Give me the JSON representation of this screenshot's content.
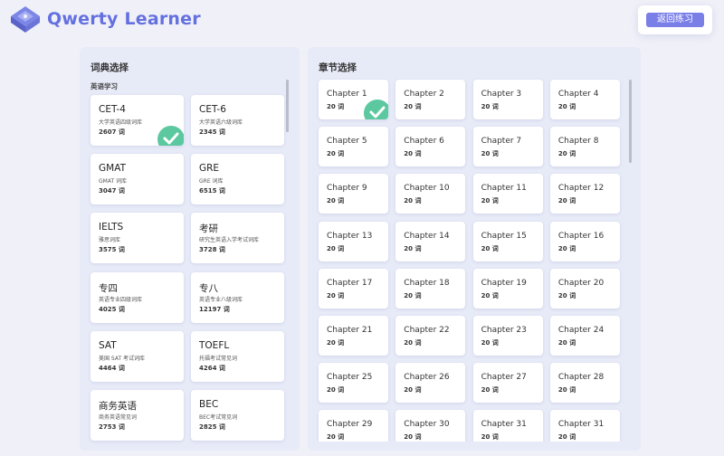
{
  "app": {
    "title": "Qwerty Learner",
    "back_label": "返回练习"
  },
  "dict_panel": {
    "title": "词典选择",
    "category": "英语学习",
    "items": [
      {
        "name": "CET-4",
        "desc": "大学英语四级词库",
        "count": "2607 词",
        "selected": true
      },
      {
        "name": "CET-6",
        "desc": "大学英语六级词库",
        "count": "2345 词"
      },
      {
        "name": "GMAT",
        "desc": "GMAT 词库",
        "count": "3047 词"
      },
      {
        "name": "GRE",
        "desc": "GRE 词库",
        "count": "6515 词"
      },
      {
        "name": "IELTS",
        "desc": "雅思词库",
        "count": "3575 词"
      },
      {
        "name": "考研",
        "desc": "研究生英语入学考试词库",
        "count": "3728 词"
      },
      {
        "name": "专四",
        "desc": "英语专业四级词库",
        "count": "4025 词"
      },
      {
        "name": "专八",
        "desc": "英语专业八级词库",
        "count": "12197 词"
      },
      {
        "name": "SAT",
        "desc": "美国 SAT 考试词库",
        "count": "4464 词"
      },
      {
        "name": "TOEFL",
        "desc": "托福考试常见词",
        "count": "4264 词"
      },
      {
        "name": "商务英语",
        "desc": "商务英语常见词",
        "count": "2753 词"
      },
      {
        "name": "BEC",
        "desc": "BEC考试常见词",
        "count": "2825 词"
      }
    ]
  },
  "chapter_panel": {
    "title": "章节选择",
    "items": [
      {
        "name": "Chapter 1",
        "count": "20 词",
        "selected": true
      },
      {
        "name": "Chapter 2",
        "count": "20 词"
      },
      {
        "name": "Chapter 3",
        "count": "20 词"
      },
      {
        "name": "Chapter 4",
        "count": "20 词"
      },
      {
        "name": "Chapter 5",
        "count": "20 词"
      },
      {
        "name": "Chapter 6",
        "count": "20 词"
      },
      {
        "name": "Chapter 7",
        "count": "20 词"
      },
      {
        "name": "Chapter 8",
        "count": "20 词"
      },
      {
        "name": "Chapter 9",
        "count": "20 词"
      },
      {
        "name": "Chapter 10",
        "count": "20 词"
      },
      {
        "name": "Chapter 11",
        "count": "20 词"
      },
      {
        "name": "Chapter 12",
        "count": "20 词"
      },
      {
        "name": "Chapter 13",
        "count": "20 词"
      },
      {
        "name": "Chapter 14",
        "count": "20 词"
      },
      {
        "name": "Chapter 15",
        "count": "20 词"
      },
      {
        "name": "Chapter 16",
        "count": "20 词"
      },
      {
        "name": "Chapter 17",
        "count": "20 词"
      },
      {
        "name": "Chapter 18",
        "count": "20 词"
      },
      {
        "name": "Chapter 19",
        "count": "20 词"
      },
      {
        "name": "Chapter 20",
        "count": "20 词"
      },
      {
        "name": "Chapter 21",
        "count": "20 词"
      },
      {
        "name": "Chapter 22",
        "count": "20 词"
      },
      {
        "name": "Chapter 23",
        "count": "20 词"
      },
      {
        "name": "Chapter 24",
        "count": "20 词"
      },
      {
        "name": "Chapter 25",
        "count": "20 词"
      },
      {
        "name": "Chapter 26",
        "count": "20 词"
      },
      {
        "name": "Chapter 27",
        "count": "20 词"
      },
      {
        "name": "Chapter 28",
        "count": "20 词"
      },
      {
        "name": "Chapter 29",
        "count": "20 词"
      },
      {
        "name": "Chapter 30",
        "count": "20 词"
      },
      {
        "name": "Chapter 31",
        "count": "20 词"
      },
      {
        "name": "Chapter 31",
        "count": "20 词"
      }
    ]
  },
  "colors": {
    "accent": "#6470e0",
    "button": "#7a7fe8",
    "check": "#5cc8a0",
    "panel": "#e7eaf7"
  }
}
